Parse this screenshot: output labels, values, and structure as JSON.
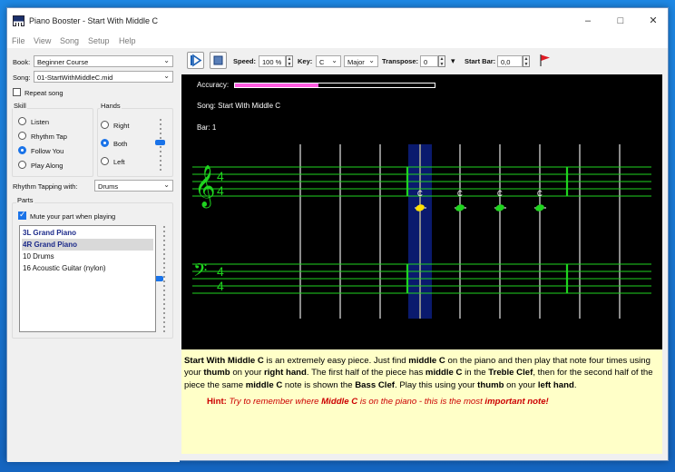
{
  "window": {
    "title": "Piano Booster - Start With Middle C"
  },
  "menu": [
    "File",
    "View",
    "Song",
    "Setup",
    "Help"
  ],
  "left": {
    "book_label": "Book:",
    "book_value": "Beginner Course",
    "song_label": "Song:",
    "song_value": "01-StartWithMiddleC.mid",
    "repeat_song": "Repeat song",
    "skill_title": "Skill",
    "skill_options": [
      "Listen",
      "Rhythm Tap",
      "Follow You",
      "Play Along"
    ],
    "skill_selected": "Follow You",
    "hands_title": "Hands",
    "hands_options": [
      "Right",
      "Both",
      "Left"
    ],
    "hands_selected": "Both",
    "rhythm_label": "Rhythm Tapping with:",
    "rhythm_value": "Drums",
    "parts_title": "Parts",
    "mute_label": "Mute your part when playing",
    "parts": [
      "3L Grand Piano",
      "4R Grand Piano",
      "10 Drums",
      "16 Acoustic Guitar (nylon)"
    ]
  },
  "toolbar": {
    "speed_label": "Speed:",
    "speed_value": "100 %",
    "key_label": "Key:",
    "key_value": "C",
    "mode_value": "Major",
    "transpose_label": "Transpose:",
    "transpose_value": "0",
    "startbar_label": "Start Bar:",
    "startbar_value": "0,0"
  },
  "score": {
    "accuracy_label": "Accuracy:",
    "accuracy_fraction": 0.42,
    "song_line": "Song: Start With Middle C",
    "bar_line": "Bar: 1",
    "time_sig_top": "4",
    "time_sig_bottom": "4",
    "note_name": "C",
    "colors": {
      "staff": "#1fd41f",
      "played_note": "#ffe000",
      "note": "#1fd41f",
      "highlight": "#0a1a6e",
      "accuracy": "#ff5ce0"
    }
  },
  "description": {
    "hint_label": "Hint:",
    "hint_pre": "Try to remember where ",
    "hint_mid": "Middle C",
    "hint_post": " is on the piano - this is the most ",
    "hint_strong": "important note!"
  }
}
